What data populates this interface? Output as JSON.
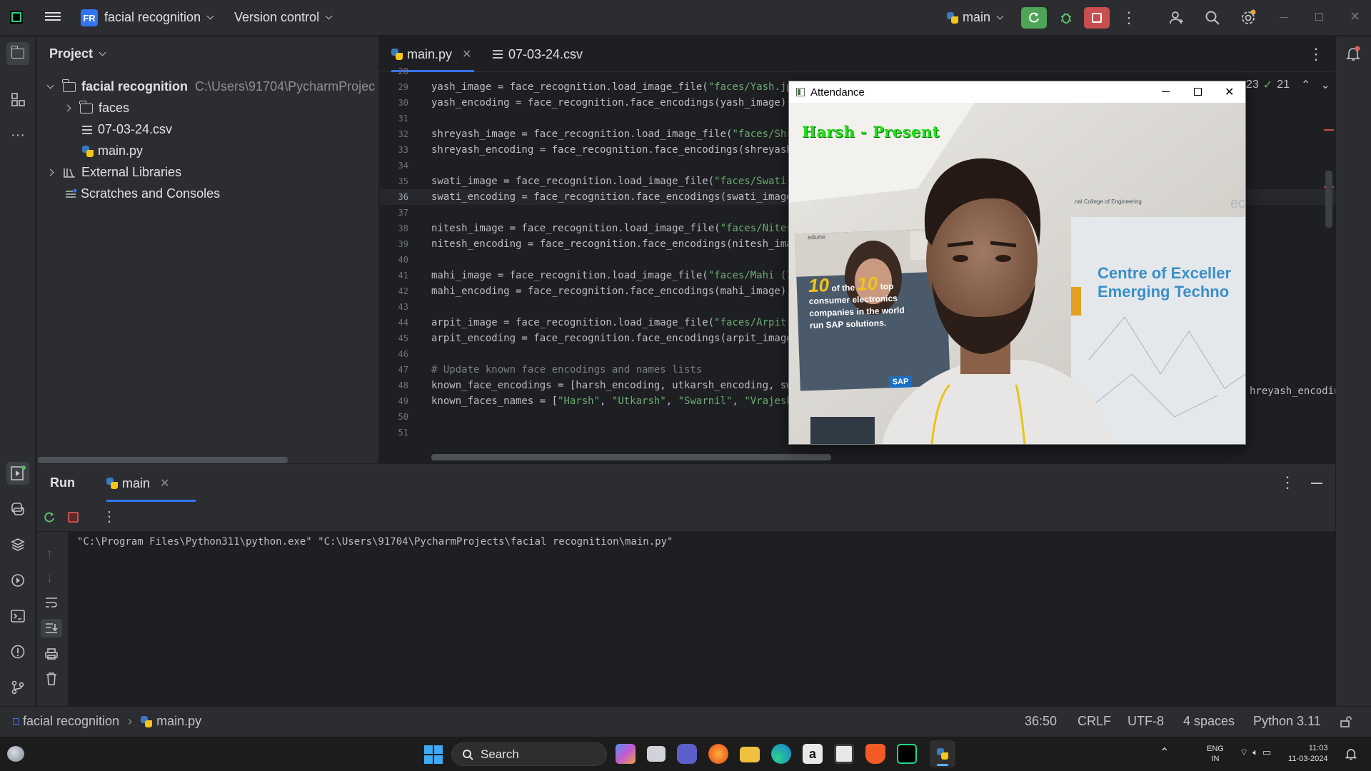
{
  "titlebar": {
    "project_badge": "FR",
    "project_name": "facial recognition",
    "version_control": "Version control",
    "run_config": "main"
  },
  "project_pane": {
    "title": "Project",
    "root_name": "facial recognition",
    "root_path": "C:\\Users\\91704\\PycharmProjec",
    "items": [
      "faces",
      "07-03-24.csv",
      "main.py"
    ],
    "external_libraries": "External Libraries",
    "scratches": "Scratches and Consoles"
  },
  "editor": {
    "tabs": [
      "main.py",
      "07-03-24.csv"
    ],
    "inspections": {
      "warnings": "23",
      "checks": "21"
    },
    "current_line": "36",
    "lines": [
      {
        "n": "28",
        "t": ""
      },
      {
        "n": "29",
        "t": "yash_image = face_recognition.load_image_file(",
        "s": "\"faces/Yash.jpeg\"",
        "e": ""
      },
      {
        "n": "30",
        "t": "yash_encoding = face_recognition.face_encodings(yash_image)[",
        "num": "0",
        "e": "]"
      },
      {
        "n": "31",
        "t": ""
      },
      {
        "n": "32",
        "t": "shreyash_image = face_recognition.load_image_file(",
        "s": "\"faces/Shreya",
        "e": ""
      },
      {
        "n": "33",
        "t": "shreyash_encoding = face_recognition.face_encodings(shreyash_im",
        "e": ""
      },
      {
        "n": "34",
        "t": ""
      },
      {
        "n": "35",
        "t": "swati_image = face_recognition.load_image_file(",
        "s": "\"faces/Swati.jpe",
        "e": ""
      },
      {
        "n": "36",
        "t": "swati_encoding = face_recognition.face_encodings(swati_image)[",
        "num": "0",
        "e": ""
      },
      {
        "n": "37",
        "t": ""
      },
      {
        "n": "38",
        "t": "nitesh_image = face_recognition.load_image_file(",
        "s": "\"faces/Nitesh.j",
        "e": ""
      },
      {
        "n": "39",
        "t": "nitesh_encoding = face_recognition.face_encodings(nitesh_image)",
        "e": ""
      },
      {
        "n": "40",
        "t": ""
      },
      {
        "n": "41",
        "t": "mahi_image = face_recognition.load_image_file(",
        "s": "\"faces/Mahi (1).j",
        "e": ""
      },
      {
        "n": "42",
        "t": "mahi_encoding = face_recognition.face_encodings(mahi_image)[",
        "num": "0",
        "e": "]"
      },
      {
        "n": "43",
        "t": ""
      },
      {
        "n": "44",
        "t": "arpit_image = face_recognition.load_image_file(",
        "s": "\"faces/Arpit.jp",
        "e": ""
      },
      {
        "n": "45",
        "t": "arpit_encoding = face_recognition.face_encodings(arpit_image)[",
        "num": "0",
        "e": ""
      },
      {
        "n": "46",
        "t": ""
      },
      {
        "n": "47",
        "c": "# Update known face encodings and names lists"
      },
      {
        "n": "48",
        "t": "known_face_encodings = [harsh_encoding, utkarsh_encoding, swarn",
        "e": ""
      },
      {
        "n": "49",
        "t": "known_faces_names = [",
        "names": [
          "\"Harsh\"",
          "\"Utkarsh\"",
          "\"Swarnil\"",
          "\"Vrajesh\""
        ],
        "e": ""
      },
      {
        "n": "50",
        "t": ""
      },
      {
        "n": "51",
        "t": ""
      }
    ],
    "overflow_right": "hreyash_encoding"
  },
  "attendance_window": {
    "title": "Attendance",
    "overlay_text": "Harsh - Present",
    "poster_headline_num1": "10",
    "poster_headline_num2": "10",
    "poster_of_the": "of the",
    "poster_top": "top",
    "poster_line2": "consumer electronics",
    "poster_line3": "companies in the world",
    "poster_line4": "run SAP solutions.",
    "poster_brand": "SAP",
    "poster_brand2": "edune",
    "banner_line1": "Centre of Exceller",
    "banner_line2": "Emerging Techno",
    "banner_small": "nal College of Engineering",
    "banner_corner": "ec"
  },
  "run_panel": {
    "tab_run": "Run",
    "tab_main": "main",
    "console_output": "\"C:\\Program Files\\Python311\\python.exe\" \"C:\\Users\\91704\\PycharmProjects\\facial recognition\\main.py\""
  },
  "statusbar": {
    "breadcrumb_project": "facial recognition",
    "breadcrumb_file": "main.py",
    "position": "36:50",
    "line_sep": "CRLF",
    "encoding": "UTF-8",
    "indent": "4 spaces",
    "interpreter": "Python 3.11"
  },
  "taskbar": {
    "search": "Search",
    "lang_line1": "ENG",
    "lang_line2": "IN",
    "time": "11:03",
    "date": "11-03-2024"
  }
}
